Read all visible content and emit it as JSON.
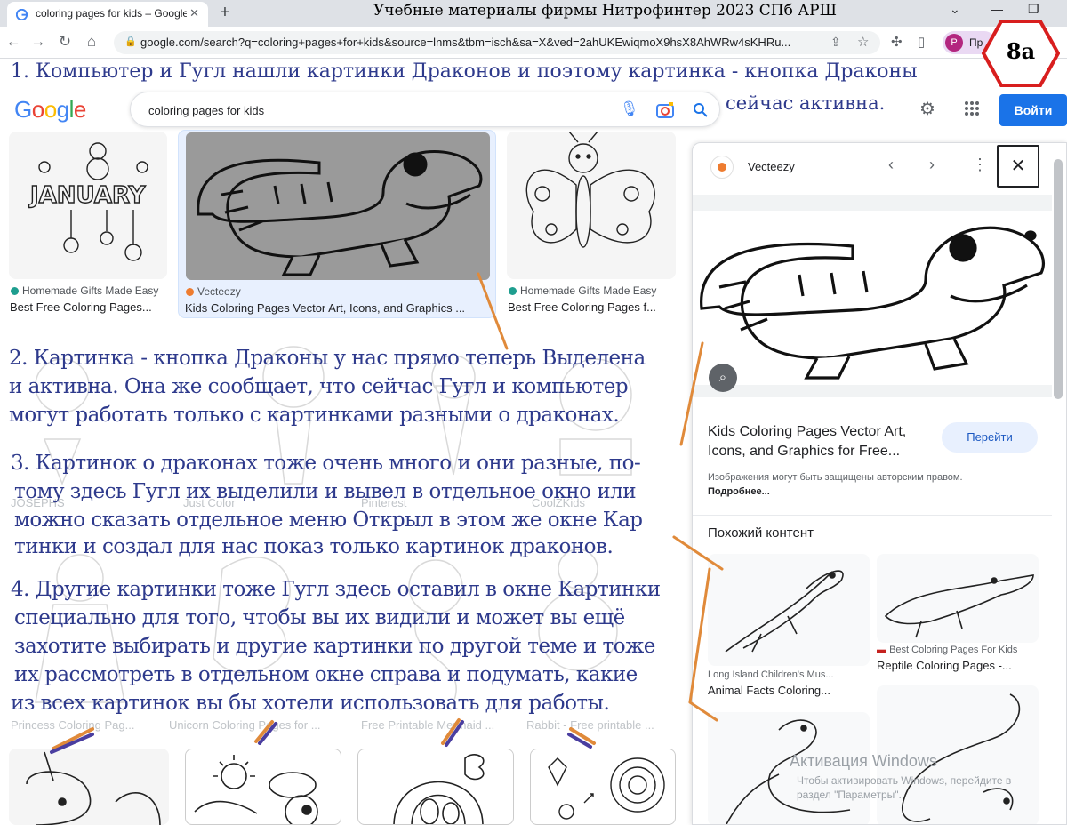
{
  "browser": {
    "tab_title": "coloring pages for kids – Google",
    "tab_close": "✕",
    "new_tab": "+",
    "window_title": "Учебные материалы фирмы Нитрофинтер 2023 СПб АРШ",
    "url": "google.com/search?q=coloring+pages+for+kids&source=lnms&tbm=isch&sa=X&ved=2ahUKEwiqmoX9hsX8AhWRw4sKHRu...",
    "profile_initial": "P",
    "profile_label": "Пр"
  },
  "google": {
    "search_value": "coloring pages for kids",
    "signin_label": "Войти"
  },
  "results": [
    {
      "source": "Homemade Gifts Made Easy",
      "title": "Best Free Coloring Pages...",
      "source_color": "#1e9e8f"
    },
    {
      "source": "Vecteezy",
      "title": "Kids Coloring Pages Vector Art, Icons, and Graphics ...",
      "source_color": "#ee7c30"
    },
    {
      "source": "Homemade Gifts Made Easy",
      "title": "Best Free Coloring Pages f...",
      "source_color": "#1e9e8f"
    }
  ],
  "faded_rows": {
    "row2_sources": [
      "JOSEPHS",
      "Just Color",
      "Pinterest",
      "CoolZKids"
    ],
    "row3_titles": [
      "Princess Coloring Pag...",
      "Unicorn Coloring Pages for ...",
      "Free Printable Mermaid ...",
      "Rabbit - Free printable ..."
    ]
  },
  "panel": {
    "source": "Vecteezy",
    "title": "Kids Coloring Pages Vector Art, Icons, and Graphics for Free...",
    "visit_label": "Перейти",
    "copyright": "Изображения могут быть защищены авторским правом.",
    "copyright_more": "Подробнее...",
    "similar_heading": "Похожий контент",
    "similar": [
      {
        "source": "Long Island Children's Mus...",
        "title": "Animal Facts Coloring..."
      },
      {
        "source": "Best Coloring Pages For Kids",
        "title": "Reptile Coloring Pages -..."
      }
    ]
  },
  "annotations": {
    "badge": "8a",
    "line1a": "1. Компьютер и Гугл нашли картинки Драконов и поэтому картинка - кнопка Драконы",
    "line1b": "сейчас активна.",
    "p2": [
      "2. Картинка - кнопка Драконы у нас прямо теперь Выделена",
      " и активна. Она же сообщает, что сейчас Гугл и компьютер",
      " могут работать только с картинками разными о драконах."
    ],
    "p3": [
      "3. Картинок о драконах тоже очень много и они разные, по-",
      "тому здесь Гугл их выделили и вывел в отдельное окно или",
      " можно сказать отдельное меню Открыл в этом же окне Кар",
      "тинки и создал для нас показ только картинок драконов."
    ],
    "p4": [
      "4. Другие картинки тоже Гугл здесь оставил в окне Картинки",
      " специально для того, чтобы вы их видили и может вы ещё",
      " захотите выбирать и другие картинки по другой теме и тоже",
      " их рассмотреть в отдельном окне справа и подумать, какие",
      "из всех картинок вы бы хотели использовать для работы."
    ]
  },
  "watermark": {
    "title": "Активация Windows",
    "line1": "Чтобы активировать Windows, перейдите в",
    "line2": "раздел \"Параметры\"."
  }
}
